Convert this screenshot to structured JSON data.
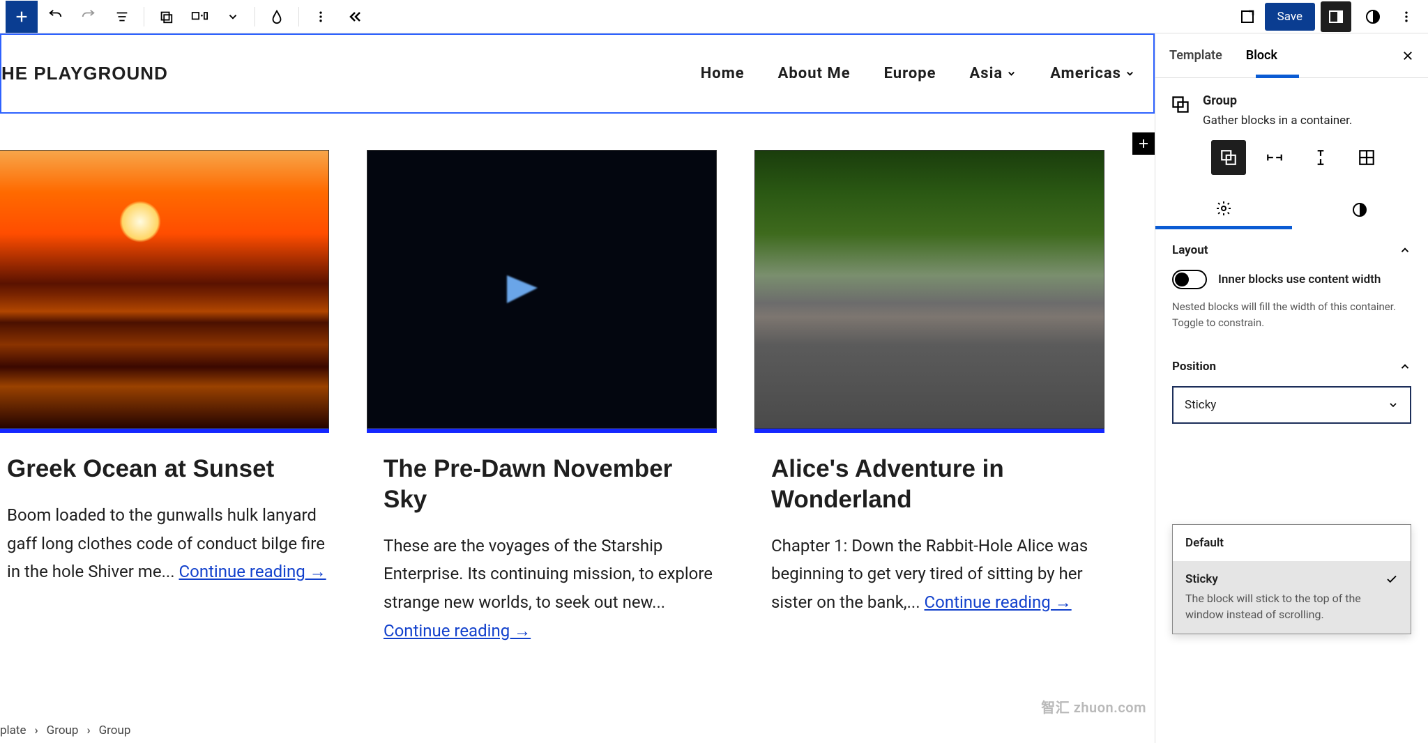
{
  "topbar": {
    "save": "Save"
  },
  "site": {
    "title": "HE PLAYGROUND",
    "menu": [
      "Home",
      "About Me",
      "Europe",
      "Asia",
      "Americas"
    ]
  },
  "cards": [
    {
      "title": "Greek Ocean at Sunset",
      "excerpt": "Boom loaded to the gunwalls hulk lanyard gaff long clothes code of conduct bilge fire in the hole Shiver me... ",
      "cr": "Continue reading →"
    },
    {
      "title": "The Pre-Dawn November Sky",
      "excerpt": "These are the voyages of the Starship Enterprise. Its continuing mission, to explore strange new worlds, to seek out new...",
      "cr": "Continue reading →"
    },
    {
      "title": "Alice's Adventure in Wonderland",
      "excerpt": "Chapter 1: Down the Rabbit-Hole Alice was beginning to get very tired of sitting by her sister on the bank,... ",
      "cr": "Continue reading →"
    }
  ],
  "sidebar": {
    "tabs": {
      "template": "Template",
      "block": "Block"
    },
    "block": {
      "name": "Group",
      "desc": "Gather blocks in a container."
    },
    "layout": {
      "title": "Layout",
      "toggle": "Inner blocks use content width",
      "help": "Nested blocks will fill the width of this container. Toggle to constrain."
    },
    "position": {
      "title": "Position",
      "selected": "Sticky",
      "options": [
        {
          "label": "Default"
        },
        {
          "label": "Sticky",
          "desc": "The block will stick to the top of the window instead of scrolling."
        }
      ]
    }
  },
  "breadcrumb": [
    "plate",
    "Group",
    "Group"
  ],
  "watermark": {
    "zh": "智汇",
    "en": " zhuon.com"
  }
}
